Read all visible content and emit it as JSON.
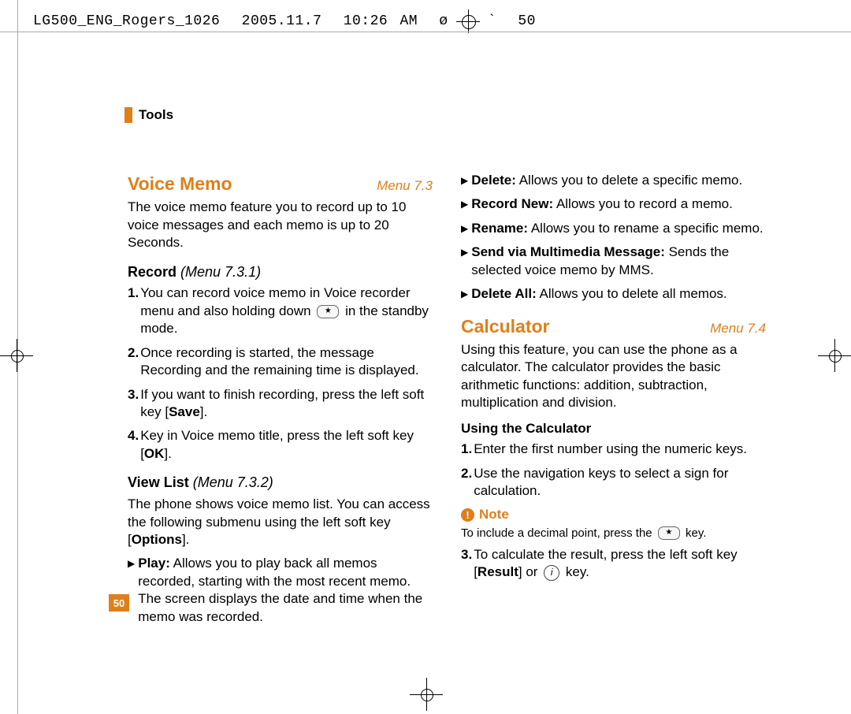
{
  "crop": {
    "file_label": "LG500_ENG_Rogers_1026",
    "date": "2005.11.7",
    "time": "10:26 AM",
    "extra1": "ø",
    "extra2": "`",
    "page_seq": "50"
  },
  "section": "Tools",
  "page_number": "50",
  "left_col": {
    "voice_memo_title": "Voice Memo",
    "voice_memo_menu": "Menu 7.3",
    "voice_memo_intro": "The voice memo feature you to record up to 10 voice messages and each memo is up to 20 Seconds.",
    "record_title": "Record",
    "record_menu": "(Menu 7.3.1)",
    "record_items": [
      {
        "num": "1.",
        "pre": "You can record voice memo in Voice recorder menu and also holding down ",
        "key": "★",
        "post": " in the standby mode."
      },
      {
        "num": "2.",
        "text": "Once recording is started, the message Recording and the remaining time is displayed."
      },
      {
        "num": "3.",
        "pre": "If you want to finish recording, press the left soft key [",
        "bold": "Save",
        "post": "]."
      },
      {
        "num": "4.",
        "pre": "Key in Voice memo title, press the left soft key [",
        "bold": "OK",
        "post": "]."
      }
    ],
    "viewlist_title": "View List",
    "viewlist_menu": "(Menu 7.3.2)",
    "viewlist_intro_pre": "The phone shows voice memo list. You can access the following submenu using the left soft key [",
    "viewlist_intro_bold": "Options",
    "viewlist_intro_post": "].",
    "play_label": "Play:",
    "play_text": " Allows you to play back all memos recorded, starting with the most recent memo. The screen displays the date and time when the memo was recorded."
  },
  "right_col": {
    "bullets": [
      {
        "label": "Delete:",
        "text": " Allows you to delete a specific memo."
      },
      {
        "label": "Record New:",
        "text": " Allows you to record a memo."
      },
      {
        "label": "Rename:",
        "text": " Allows you to rename a specific memo."
      },
      {
        "label": "Send via Multimedia Message:",
        "text": " Sends the selected voice memo by MMS."
      },
      {
        "label": "Delete All:",
        "text": " Allows you to delete all memos."
      }
    ],
    "calc_title": "Calculator",
    "calc_menu": "Menu 7.4",
    "calc_intro": "Using this feature, you can use the phone as a calculator. The calculator provides the basic arithmetic functions: addition, subtraction, multiplication and division.",
    "using_title": "Using the Calculator",
    "using_items": [
      {
        "num": "1.",
        "text": "Enter the first number using the numeric keys."
      },
      {
        "num": "2.",
        "text": "Use the navigation keys to select a sign for calculation."
      }
    ],
    "note_label": "Note",
    "note_pre": "To include a decimal point, press the ",
    "note_key": "★",
    "note_post": " key.",
    "item3_num": "3.",
    "item3_pre": "To calculate the result, press the left soft key [",
    "item3_bold": "Result",
    "item3_mid": "] or ",
    "item3_key": "i",
    "item3_post": " key."
  }
}
